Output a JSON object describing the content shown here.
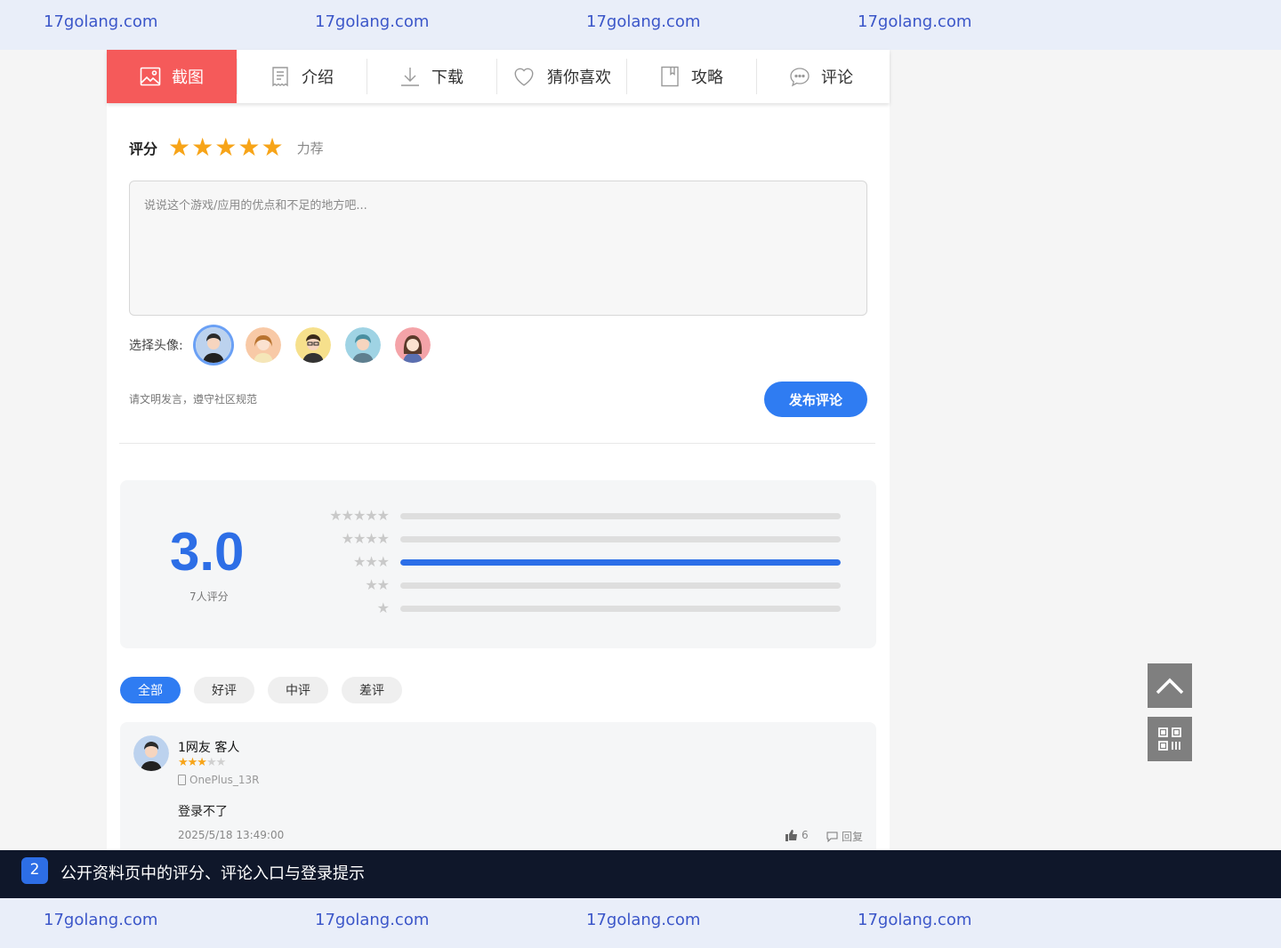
{
  "watermark": {
    "text": "17golang.com"
  },
  "tabs": [
    {
      "label": "截图",
      "icon": "image-icon",
      "active": true
    },
    {
      "label": "介绍",
      "icon": "document-icon"
    },
    {
      "label": "下载",
      "icon": "download-icon"
    },
    {
      "label": "猜你喜欢",
      "icon": "heart-icon"
    },
    {
      "label": "攻略",
      "icon": "book-icon"
    },
    {
      "label": "评论",
      "icon": "chat-icon"
    }
  ],
  "rating": {
    "label": "评分",
    "stars": 5,
    "text": "力荐"
  },
  "comment_form": {
    "placeholder": "说说这个游戏/应用的优点和不足的地方吧...",
    "avatar_label": "选择头像:",
    "notice": "请文明发言，遵守社区规范",
    "submit_label": "发布评论"
  },
  "summary": {
    "score": "3.0",
    "count_text": "7人评分",
    "distribution": [
      {
        "stars": 5,
        "fraction": 0
      },
      {
        "stars": 4,
        "fraction": 0
      },
      {
        "stars": 3,
        "fraction": 1
      },
      {
        "stars": 2,
        "fraction": 0
      },
      {
        "stars": 1,
        "fraction": 0
      }
    ]
  },
  "filters": [
    "全部",
    "好评",
    "中评",
    "差评"
  ],
  "comments": [
    {
      "name": "1网友 客人",
      "stars": 3,
      "device": "OnePlus_13R",
      "body": "登录不了",
      "time": "2025/5/18 13:49:00",
      "likes": "6",
      "reply_label": "回复"
    }
  ],
  "caption": {
    "number": "2",
    "text": "公开资料页中的评分、评论入口与登录提示"
  },
  "colors": {
    "accent": "#2f7cf2",
    "active_tab": "#f55a5a",
    "star": "#f7a418",
    "score": "#2d6ee6",
    "caption_bg": "#0f172a"
  }
}
